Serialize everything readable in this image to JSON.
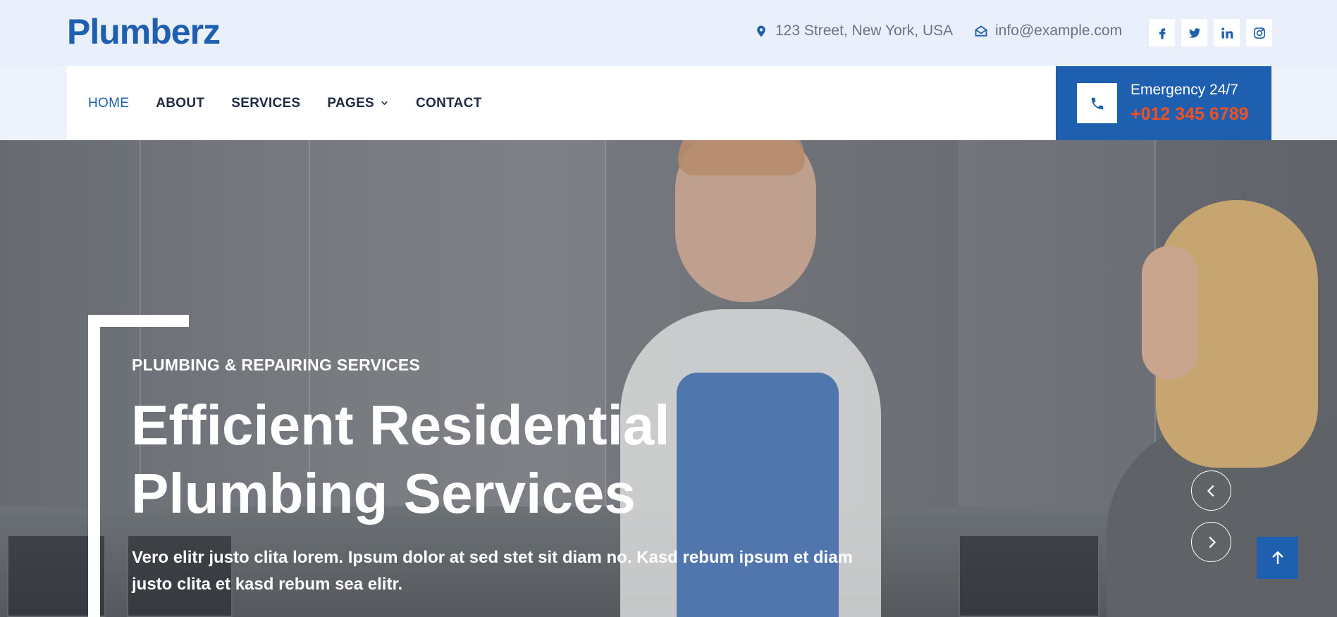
{
  "brand": {
    "name": "Plumberz"
  },
  "topbar": {
    "address": "123 Street, New York, USA",
    "email": "info@example.com",
    "socials": [
      "facebook-icon",
      "twitter-icon",
      "linkedin-icon",
      "instagram-icon"
    ]
  },
  "nav": {
    "items": [
      {
        "label": "HOME",
        "active": true
      },
      {
        "label": "ABOUT",
        "active": false
      },
      {
        "label": "SERVICES",
        "active": false
      },
      {
        "label": "PAGES",
        "active": false,
        "dropdown": true
      },
      {
        "label": "CONTACT",
        "active": false
      }
    ]
  },
  "emergency": {
    "label": "Emergency 24/7",
    "number": "+012 345 6789"
  },
  "hero": {
    "subtitle": "PLUMBING & REPAIRING SERVICES",
    "headline_line1": "Efficient Residential",
    "headline_line2": "Plumbing Services",
    "description": "Vero elitr justo clita lorem. Ipsum dolor at sed stet sit diam no. Kasd rebum ipsum et diam justo clita et kasd rebum sea elitr."
  },
  "colors": {
    "primary": "#1f5fb0",
    "accent": "#f4511e",
    "topbar_bg": "#eaf0fb"
  }
}
